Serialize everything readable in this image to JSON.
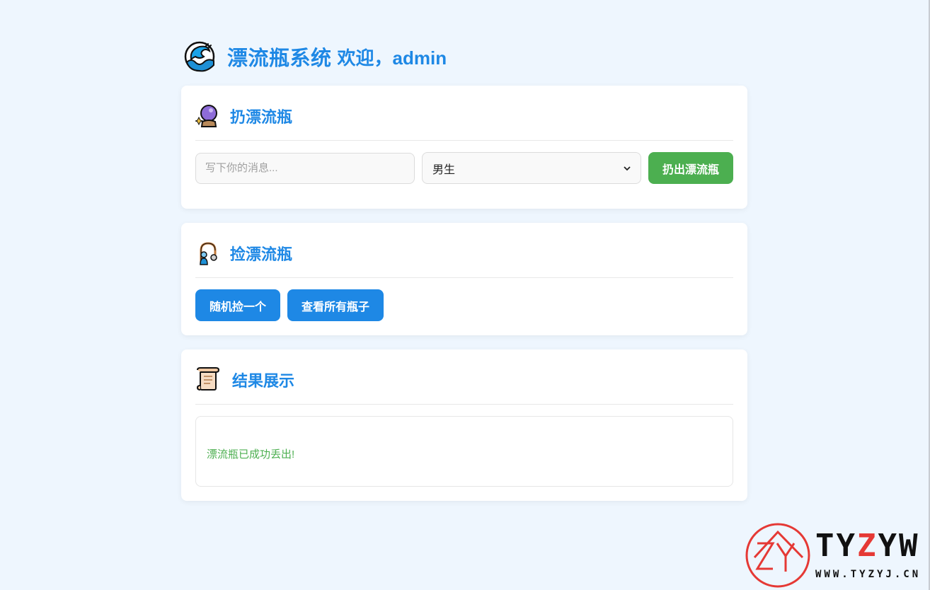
{
  "header": {
    "title": "漂流瓶系统",
    "welcome": "欢迎，admin",
    "icon": "wave-icon"
  },
  "throw_card": {
    "title": "扔漂流瓶",
    "icon": "crystal-ball-icon",
    "message_placeholder": "写下你的消息...",
    "message_value": "",
    "gender_selected": "男生",
    "submit_label": "扔出漂流瓶"
  },
  "pick_card": {
    "title": "捡漂流瓶",
    "icon": "fishing-person-icon",
    "random_label": "随机捡一个",
    "view_all_label": "查看所有瓶子"
  },
  "result_card": {
    "title": "结果展示",
    "icon": "scroll-icon",
    "message": "漂流瓶已成功丢出!"
  },
  "watermark": {
    "brand_left": "TY",
    "brand_z": "Z",
    "brand_right": "YW",
    "url": "WWW.TYZYJ.CN"
  },
  "colors": {
    "accent": "#1e88e5",
    "success": "#4caf50",
    "background": "#eef6fe"
  }
}
